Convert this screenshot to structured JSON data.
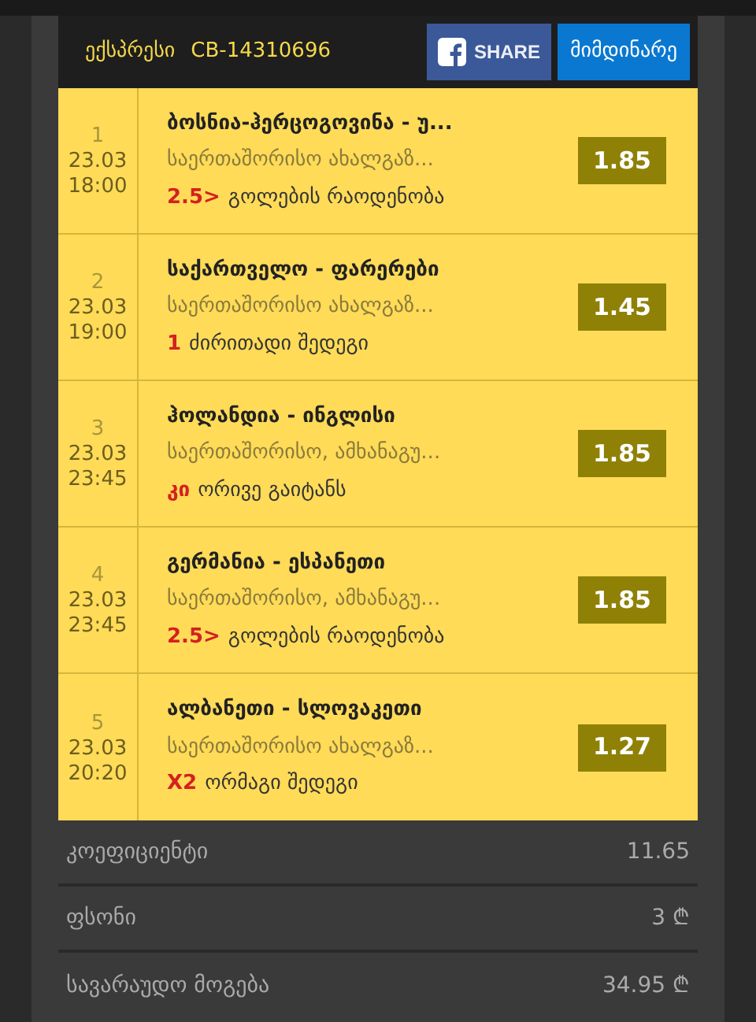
{
  "header": {
    "title": "ექსპრესი",
    "code": "CB-14310696",
    "share_button": "SHARE",
    "status_button": "მიმდინარე"
  },
  "bets": [
    {
      "number": "1",
      "date": "23.03",
      "time": "18:00",
      "match": "ბოსნია-ჰერცოგოვინა - უ...",
      "league": "საერთაშორისო ახალგაზ...",
      "pick": "2.5>",
      "market": "გოლების რაოდენობა",
      "odds": "1.85"
    },
    {
      "number": "2",
      "date": "23.03",
      "time": "19:00",
      "match": "საქართველო - ფარერები",
      "league": "საერთაშორისო ახალგაზ...",
      "pick": "1",
      "market": "ძირითადი შედეგი",
      "odds": "1.45"
    },
    {
      "number": "3",
      "date": "23.03",
      "time": "23:45",
      "match": "ჰოლანდია - ინგლისი",
      "league": "საერთაშორისო, ამხანაგუ...",
      "pick": "კი",
      "market": "ორივე გაიტანს",
      "odds": "1.85"
    },
    {
      "number": "4",
      "date": "23.03",
      "time": "23:45",
      "match": "გერმანია - ესპანეთი",
      "league": "საერთაშორისო, ამხანაგუ...",
      "pick": "2.5>",
      "market": "გოლების რაოდენობა",
      "odds": "1.85"
    },
    {
      "number": "5",
      "date": "23.03",
      "time": "20:20",
      "match": "ალბანეთი - სლოვაკეთი",
      "league": "საერთაშორისო ახალგაზ...",
      "pick": "X2",
      "market": "ორმაგი შედეგი",
      "odds": "1.27"
    }
  ],
  "summary": [
    {
      "label": "კოეფიციენტი",
      "value": "11.65"
    },
    {
      "label": "ფსონი",
      "value": "3",
      "currency": "₾"
    },
    {
      "label": "სავარაუდო მოგება",
      "value": "34.95",
      "currency": "₾"
    }
  ]
}
